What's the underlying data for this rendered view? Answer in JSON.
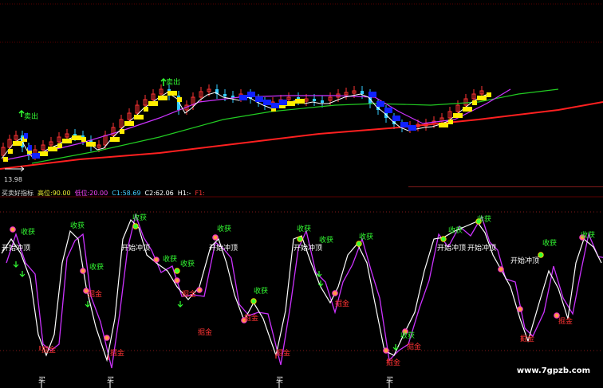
{
  "main_chart": {
    "low_price_label": "13.98",
    "sell_signal_label": "卖出"
  },
  "indicator_bar": {
    "name": "买卖好指标",
    "high_label": "高位:90.00",
    "low_label": "低位:20.00",
    "c1_label": "C1:58.69",
    "c2_label": "C2:62.06",
    "h1_label": "H1:-",
    "f1_label": "F1:_"
  },
  "oscillator": {
    "harvest_label": "收获",
    "start_top_label": "开始冲顶",
    "gold_label": "掘金",
    "buy_label": "买"
  },
  "watermark": "www.7gpzb.com",
  "colors": {
    "background": "#000000",
    "up_candle": "#ff3333",
    "down_candle": "#33ccff",
    "yellow_band": "#ffee00",
    "blue_band": "#1122ff",
    "ma_red": "#ff2020",
    "ma_green": "#22cc22",
    "ma_purple": "#cc33ff",
    "line_white": "#ffffff"
  }
}
